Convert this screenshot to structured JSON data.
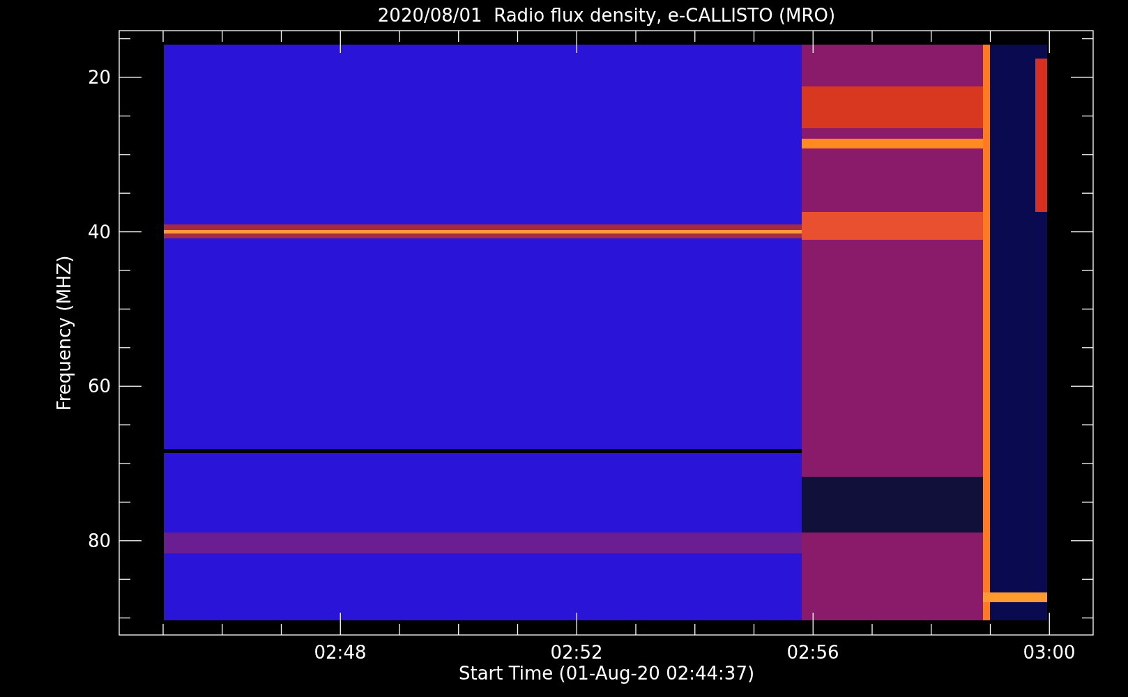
{
  "title": "2020/08/01  Radio flux density, e-CALLISTO (MRO)",
  "y_axis": {
    "label": "Frequency (MHZ)",
    "tick_labels": [
      "20",
      "40",
      "60",
      "80"
    ]
  },
  "x_axis": {
    "label": "Start Time (01-Aug-20 02:44:37)",
    "tick_labels": [
      "02:48",
      "02:52",
      "02:56",
      "03:00"
    ]
  }
}
